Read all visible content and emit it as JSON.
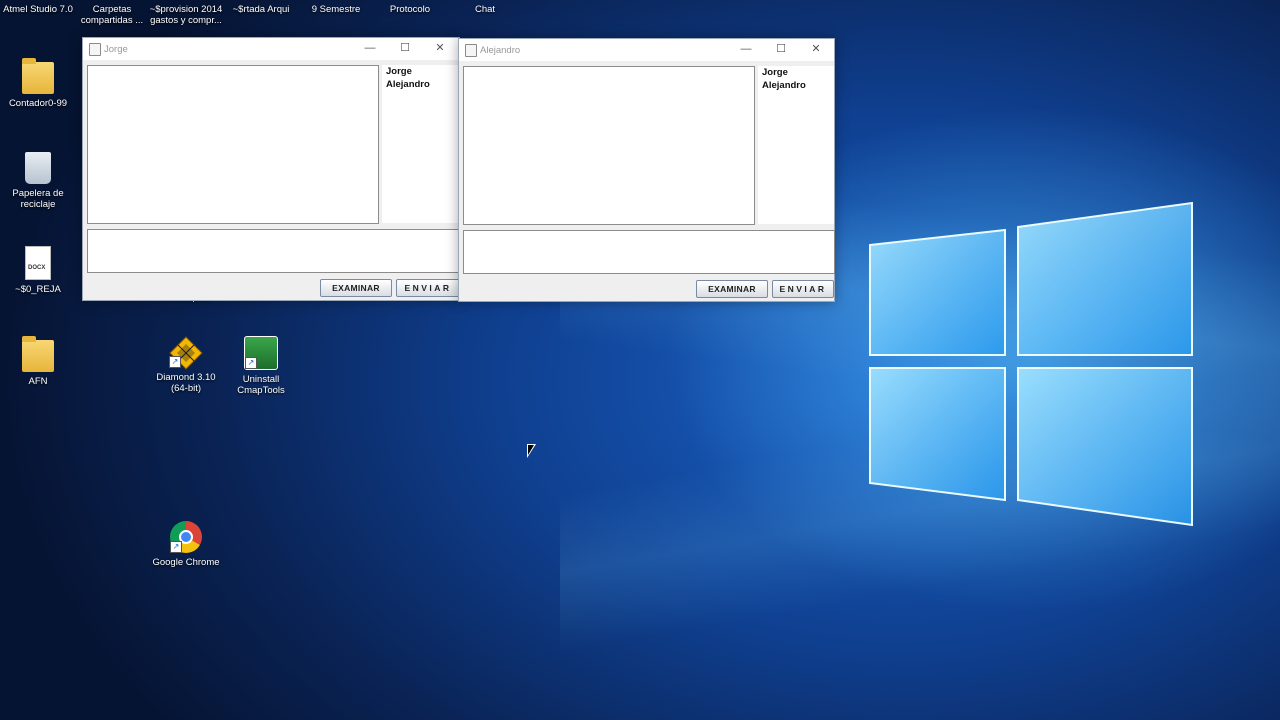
{
  "desktop": {
    "top_row": [
      {
        "label": "Atmel Studio 7.0"
      },
      {
        "label": "Carpetas compartidas ..."
      },
      {
        "label": "~$provision 2014 gastos y compr..."
      },
      {
        "label": "~$rtada Arqui"
      },
      {
        "label": "9 Semestre"
      },
      {
        "label": "Protocolo"
      },
      {
        "label": "Chat"
      }
    ],
    "icons": [
      {
        "label": "Contador0-99",
        "icon": "folder-icon"
      },
      {
        "label": "Papelera de reciclaje",
        "icon": "recycle-bin-icon"
      },
      {
        "label": "~$0_REJA",
        "icon": "docx-icon",
        "badge": "DOCX"
      },
      {
        "label": "AFN",
        "icon": "folder-icon"
      },
      {
        "label": "Diamond 3.10 (64-bit)",
        "icon": "diamond-icon"
      },
      {
        "label": "Uninstall CmapTools",
        "icon": "cmaptools-icon"
      },
      {
        "label": "Google Chrome",
        "icon": "chrome-icon"
      }
    ],
    "partial_label": "de compras"
  },
  "windows": [
    {
      "title": "Jorge",
      "users": [
        "Jorge",
        "Alejandro"
      ],
      "chat_text": "",
      "message_text": "",
      "examine_label": "EXAMINAR",
      "send_label": "ENVIAR"
    },
    {
      "title": "Alejandro",
      "users": [
        "Jorge",
        "Alejandro"
      ],
      "chat_text": "",
      "message_text": "",
      "examine_label": "EXAMINAR",
      "send_label": "ENVIAR"
    }
  ],
  "titlebar_glyphs": {
    "minimize": "—",
    "maximize": "☐",
    "close": "✕"
  }
}
